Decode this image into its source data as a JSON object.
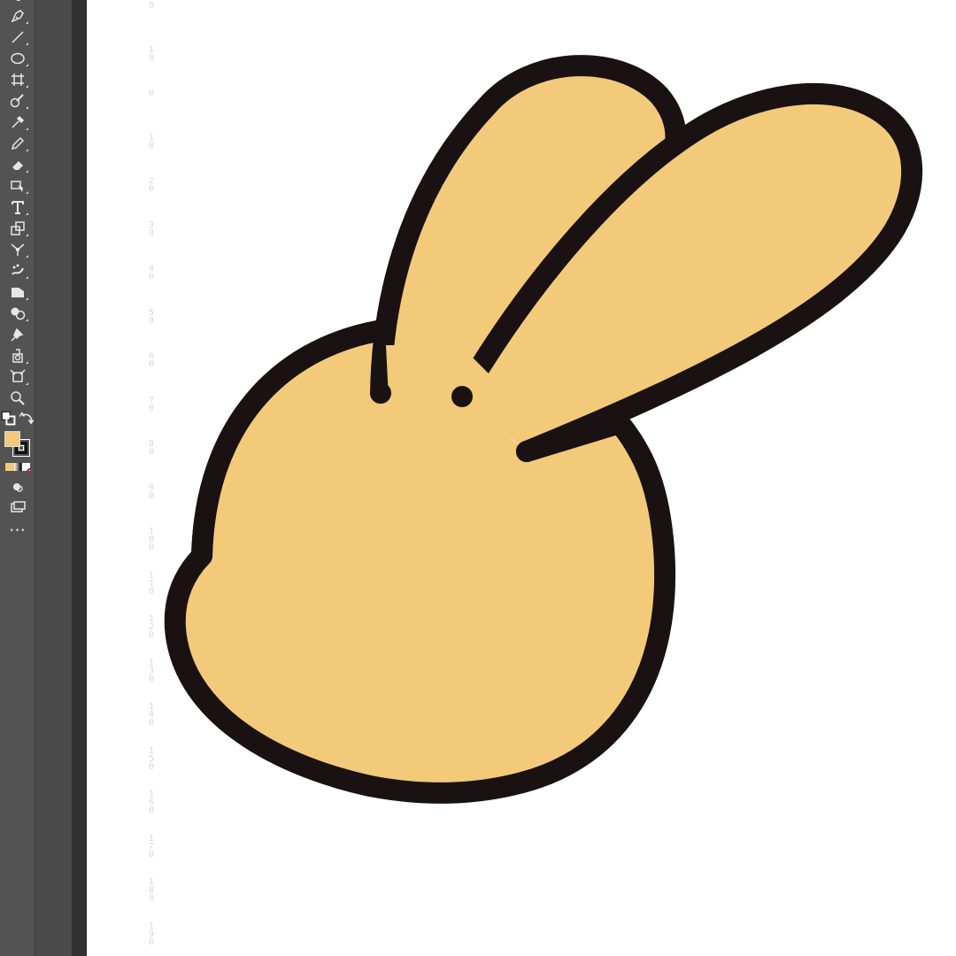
{
  "app": {
    "toolbar": {
      "tools": [
        {
          "icon": "direct-selection-icon"
        },
        {
          "icon": "pen-tool-icon"
        },
        {
          "icon": "line-segment-tool-icon"
        },
        {
          "icon": "ellipse-tool-icon"
        },
        {
          "icon": "artboard-tool-icon"
        },
        {
          "icon": "blob-brush-tool-icon"
        },
        {
          "icon": "eyedropper-tool-icon"
        },
        {
          "icon": "pencil-tool-icon"
        },
        {
          "icon": "eraser-tool-icon"
        },
        {
          "icon": "perspective-selection-tool-icon"
        },
        {
          "icon": "type-tool-icon",
          "glyph": "T"
        },
        {
          "icon": "scale-tool-icon"
        },
        {
          "icon": "puppet-warp-tool-icon"
        },
        {
          "icon": "symbol-sprayer-tool-icon"
        },
        {
          "icon": "column-graph-tool-icon"
        },
        {
          "icon": "shape-builder-tool-icon"
        },
        {
          "icon": "pin-tool-icon"
        },
        {
          "icon": "live-paint-bucket-tool-icon"
        },
        {
          "icon": "free-transform-tool-icon"
        },
        {
          "icon": "zoom-tool-icon"
        }
      ],
      "fill_color": "#f3ca79",
      "stroke_color": "#111111",
      "more_tools_glyph": "•••"
    },
    "ruler": {
      "labels": [
        "0",
        "10",
        "0",
        "10",
        "20",
        "30",
        "40",
        "50",
        "60",
        "70",
        "80",
        "90",
        "100",
        "110",
        "120",
        "130",
        "140",
        "150",
        "160",
        "170",
        "180",
        "190"
      ]
    }
  },
  "canvas": {
    "background": "#ffffff",
    "artwork": {
      "subject": "rabbit-head",
      "fill": "#f3ca79",
      "stroke": "#1a1212"
    }
  }
}
